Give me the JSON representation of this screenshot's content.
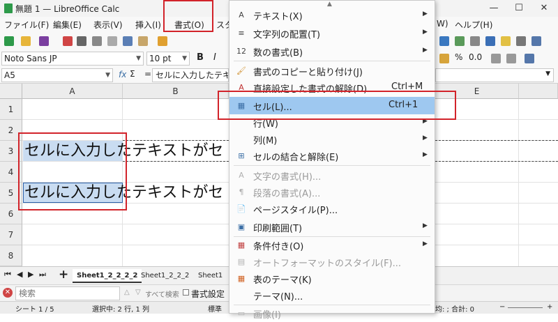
{
  "window": {
    "title": "無題 1 — LibreOffice Calc",
    "minimize": "—",
    "maximize": "☐",
    "close": "✕"
  },
  "menubar": {
    "file": "ファイル(F)",
    "edit": "編集(E)",
    "view": "表示(V)",
    "insert": "挿入(I)",
    "format": "書式(O)",
    "styles_partial": "スタ",
    "window_partial": "W)",
    "help": "ヘルプ(H)"
  },
  "formatting": {
    "font_name": "Noto Sans JP",
    "font_size": "10 pt",
    "bold": "B",
    "italic": "I",
    "percent": "%",
    "decimal": "0.0"
  },
  "formula_bar": {
    "cell_ref": "A5",
    "fx": "fx",
    "sigma": "Σ",
    "equals": "=",
    "content": "セルに入力したテキス"
  },
  "grid": {
    "columns": [
      "A",
      "B",
      "E"
    ],
    "rows": [
      "1",
      "2",
      "3",
      "4",
      "5",
      "6",
      "7",
      "8"
    ],
    "cell_text_row3": "セルに入力したテキストがセ",
    "cell_text_row5": "セルに入力したテキストがセ"
  },
  "sheet_tabs": {
    "add": "+",
    "tabs": [
      "Sheet1_2_2_2_2",
      "Sheet1_2_2_2",
      "Sheet1"
    ]
  },
  "find_bar": {
    "placeholder": "検索",
    "find_all": "すべて検索",
    "format_check": "書式設定"
  },
  "status_bar": {
    "sheet": "シート 1 / 5",
    "selection": "選択中: 2 行, 1 列",
    "style": "標準",
    "sum_partial": "均: ; 合計: 0"
  },
  "dropdown": {
    "items": [
      {
        "icon": "A",
        "label": "テキスト(X)",
        "submenu": true,
        "disabled": false,
        "shortcut": ""
      },
      {
        "icon": "≡",
        "label": "文字列の配置(T)",
        "submenu": true,
        "disabled": false,
        "shortcut": ""
      },
      {
        "icon": "12",
        "label": "数の書式(B)",
        "submenu": true,
        "disabled": false,
        "shortcut": ""
      },
      {
        "icon": "🖌",
        "label": "書式のコピーと貼り付け(J)",
        "submenu": false,
        "disabled": false,
        "shortcut": ""
      },
      {
        "icon": "A",
        "label": "直接設定した書式の解除(D)",
        "submenu": false,
        "disabled": false,
        "shortcut": "Ctrl+M"
      },
      {
        "icon": "▦",
        "label": "セル(L)...",
        "submenu": false,
        "disabled": false,
        "shortcut": "Ctrl+1"
      },
      {
        "icon": "",
        "label": "行(W)",
        "submenu": true,
        "disabled": false,
        "shortcut": ""
      },
      {
        "icon": "",
        "label": "列(M)",
        "submenu": true,
        "disabled": false,
        "shortcut": ""
      },
      {
        "icon": "⊞",
        "label": "セルの結合と解除(E)",
        "submenu": true,
        "disabled": false,
        "shortcut": ""
      },
      {
        "icon": "A",
        "label": "文字の書式(H)...",
        "submenu": false,
        "disabled": true,
        "shortcut": ""
      },
      {
        "icon": "¶",
        "label": "段落の書式(A)...",
        "submenu": false,
        "disabled": true,
        "shortcut": ""
      },
      {
        "icon": "📄",
        "label": "ページスタイル(P)...",
        "submenu": false,
        "disabled": false,
        "shortcut": ""
      },
      {
        "icon": "▣",
        "label": "印刷範囲(T)",
        "submenu": true,
        "disabled": false,
        "shortcut": ""
      },
      {
        "icon": "▦",
        "label": "条件付き(O)",
        "submenu": true,
        "disabled": false,
        "shortcut": ""
      },
      {
        "icon": "▤",
        "label": "オートフォーマットのスタイル(F)...",
        "submenu": false,
        "disabled": true,
        "shortcut": ""
      },
      {
        "icon": "▦",
        "label": "表のテーマ(K)",
        "submenu": false,
        "disabled": false,
        "shortcut": ""
      },
      {
        "icon": "",
        "label": "テーマ(N)...",
        "submenu": false,
        "disabled": false,
        "shortcut": ""
      },
      {
        "icon": "▭",
        "label": "画像(I)",
        "submenu": true,
        "disabled": true,
        "shortcut": ""
      }
    ]
  },
  "colors": {
    "highlight": "#9ec8f0",
    "annotation_red": "#d2232a",
    "selection": "#c9dcf1"
  }
}
